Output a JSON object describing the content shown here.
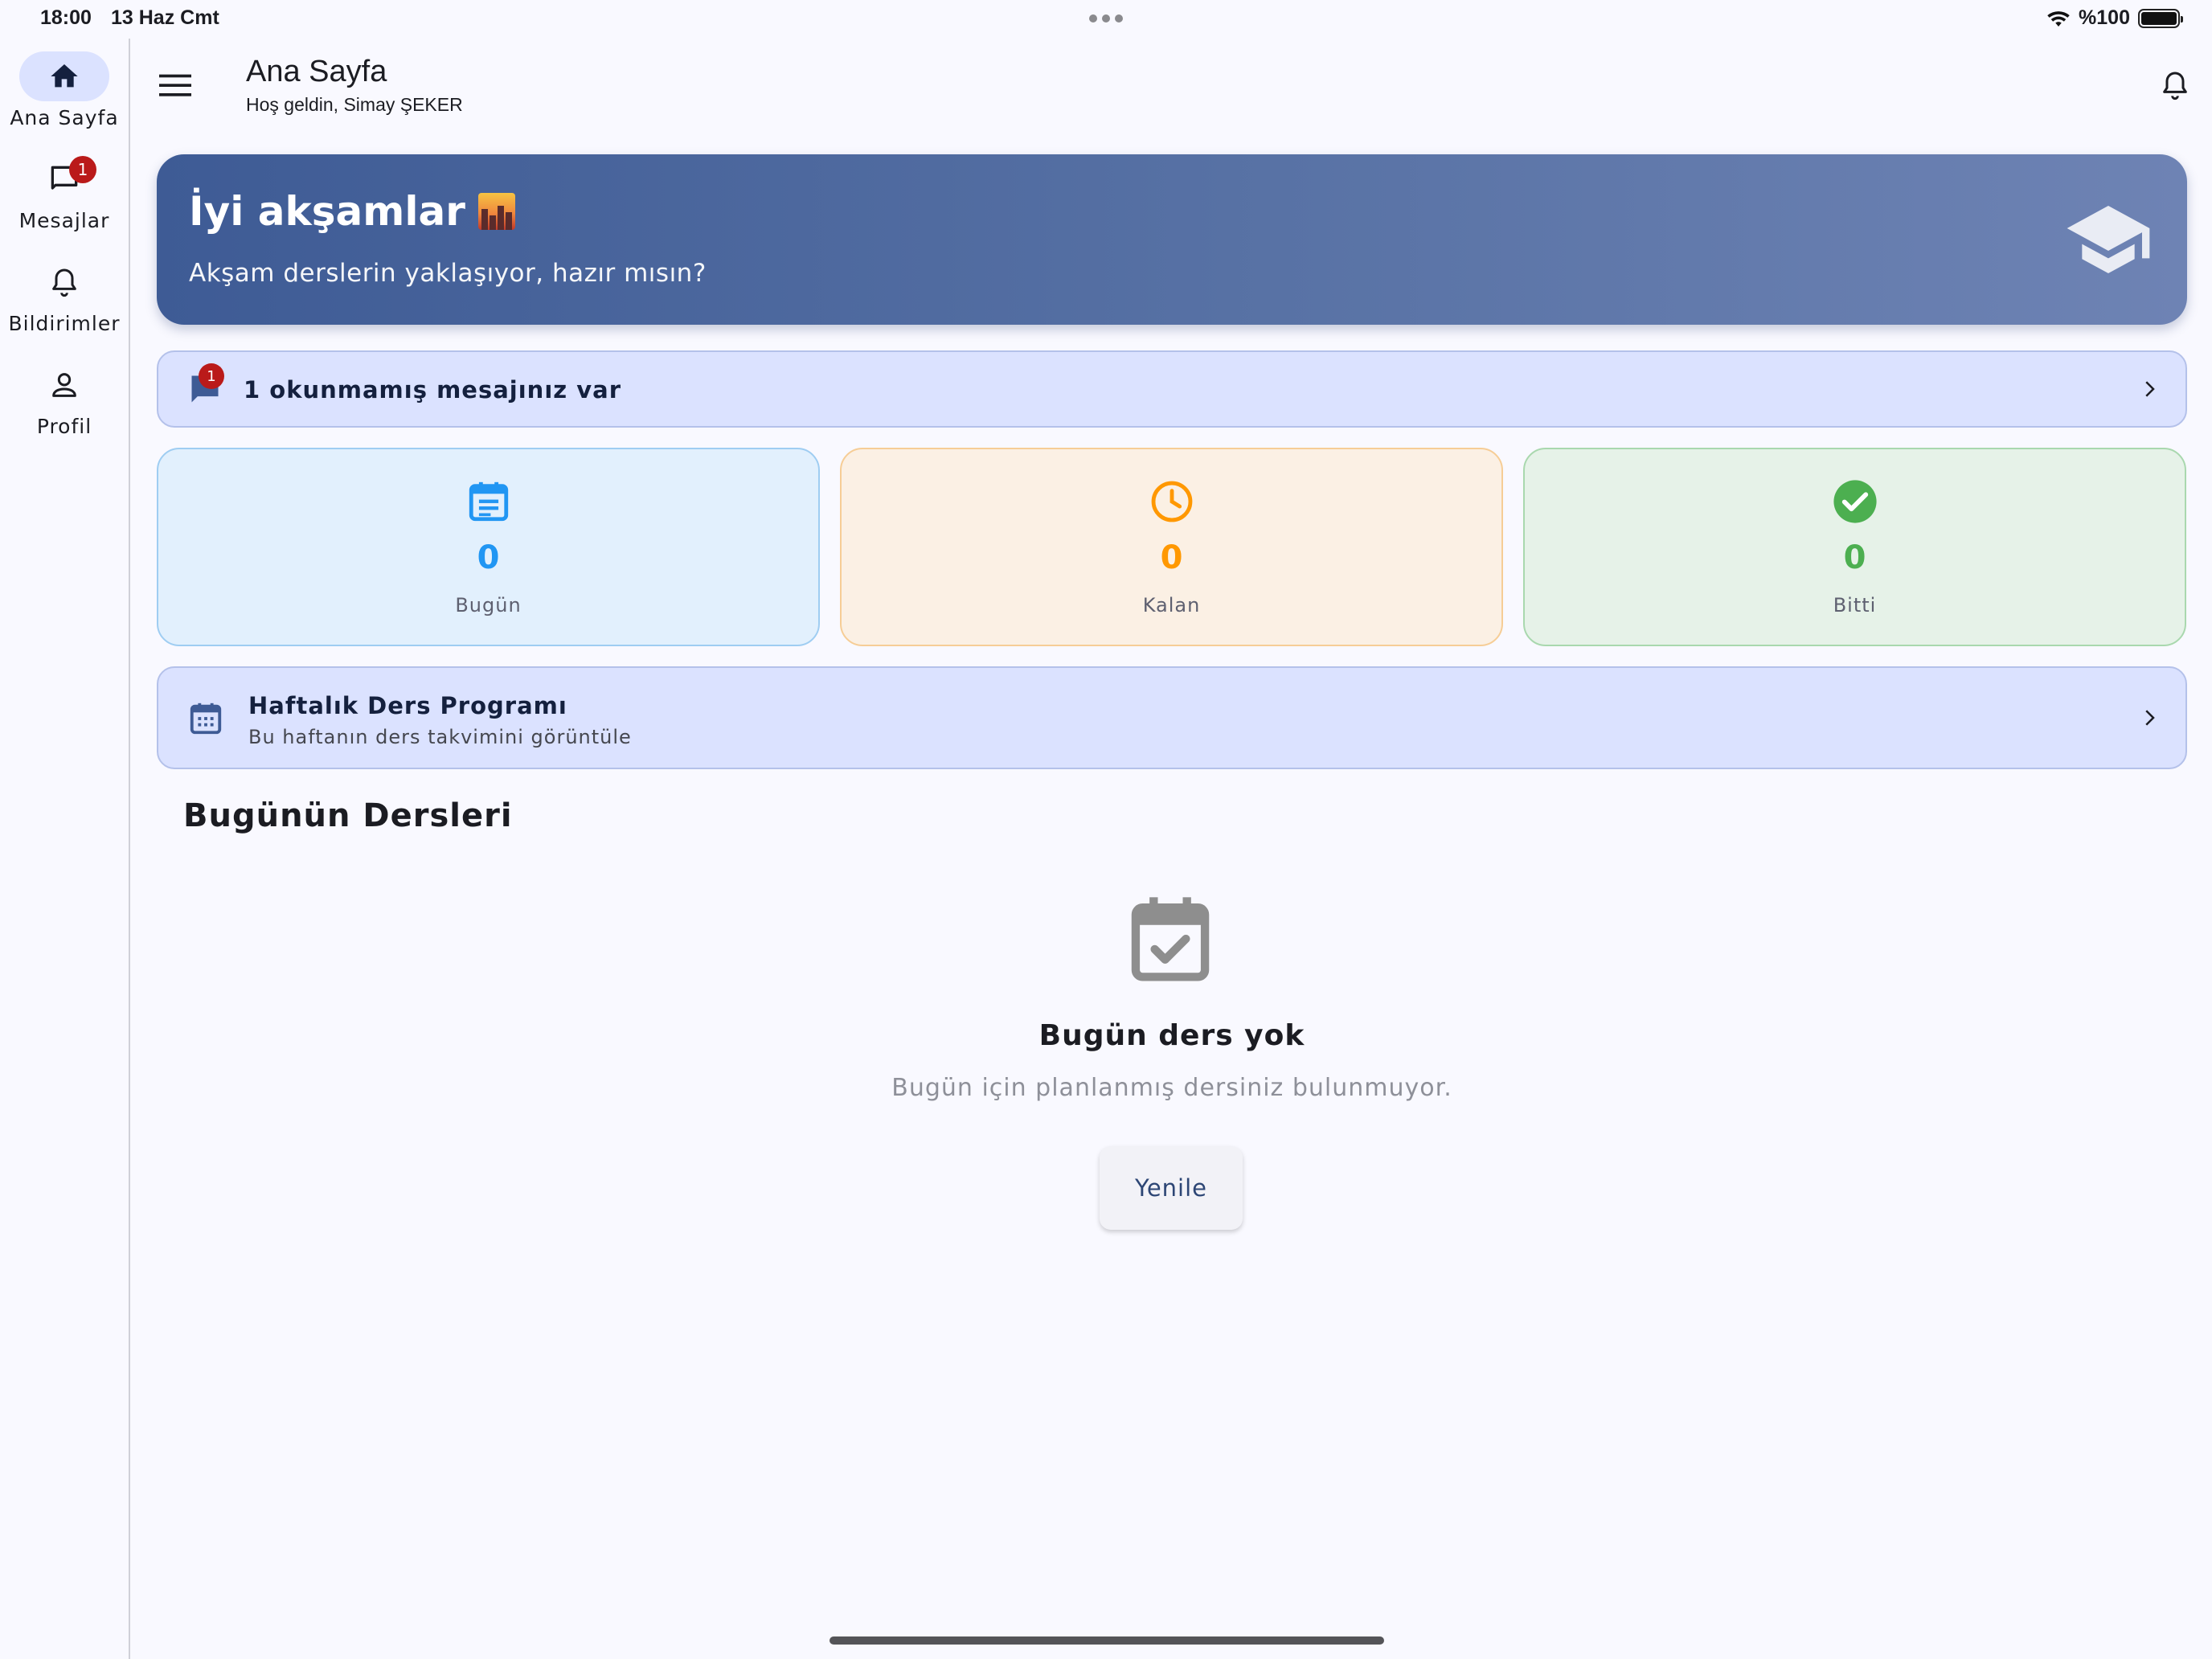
{
  "status_bar": {
    "time": "18:00",
    "date": "13 Haz Cmt",
    "battery": "%100",
    "battery_level": 1.0
  },
  "nav_rail": {
    "items": [
      {
        "label": "Ana Sayfa",
        "icon": "home-icon",
        "active": true
      },
      {
        "label": "Mesajlar",
        "icon": "chat-icon",
        "badge": "1"
      },
      {
        "label": "Bildirimler",
        "icon": "bell-icon"
      },
      {
        "label": "Profil",
        "icon": "person-icon"
      }
    ]
  },
  "app_bar": {
    "title": "Ana Sayfa",
    "subtitle": "Hoş geldin, Simay ŞEKER"
  },
  "banner": {
    "title": "İyi akşamlar",
    "subtitle": "Akşam derslerin yaklaşıyor, hazır mısın?",
    "icon": "graduation-cap-icon"
  },
  "unread": {
    "badge": "1",
    "text": "1 okunmamış mesajınız var"
  },
  "stats": [
    {
      "value": "0",
      "label": "Bugün",
      "color": "#2196f3",
      "icon": "event-note-icon"
    },
    {
      "value": "0",
      "label": "Kalan",
      "color": "#ff9800",
      "icon": "clock-icon"
    },
    {
      "value": "0",
      "label": "Bitti",
      "color": "#4caf50",
      "icon": "check-circle-icon"
    }
  ],
  "weekly": {
    "title": "Haftalık Ders Programı",
    "subtitle": "Bu haftanın ders takvimini görüntüle"
  },
  "today": {
    "title": "Bugünün Dersleri",
    "empty_title": "Bugün ders yok",
    "empty_subtitle": "Bugün için planlanmış dersiniz bulunmuyor.",
    "refresh": "Yenile"
  },
  "colors": {
    "accent": "#3e5b95",
    "surface": "#dbe2ff",
    "badge": "#ba1a1a"
  }
}
